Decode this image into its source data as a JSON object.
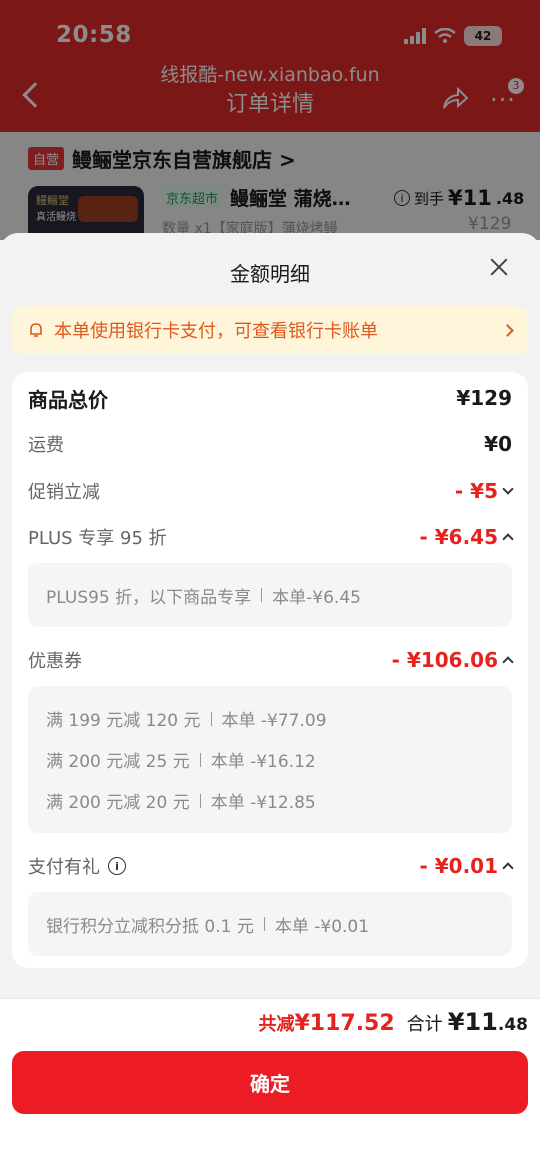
{
  "status": {
    "time": "20:58",
    "battery": "42"
  },
  "watermark": "线报酷-new.xianbao.fun",
  "nav": {
    "title": "订单详情",
    "more_badge": "3"
  },
  "store": {
    "tag": "自营",
    "name": "鳗鲡堂京东自营旗舰店 >"
  },
  "product": {
    "image_text_1": "鳗鲡堂",
    "image_text_2": "真活鳗烧",
    "channel_tag": "京东超市",
    "name": "鳗鲡堂 蒲烧…",
    "price_label": "到手",
    "price_int": "¥11",
    "price_dec": ".48",
    "subtitle": "数量 x1【家庭版】蒲烧烤鳗",
    "original_price": "¥129"
  },
  "sheet": {
    "title": "金额明细",
    "notice": "本单使用银行卡支付，可查看银行卡账单",
    "rows": {
      "total": {
        "label": "商品总价",
        "value": "¥129"
      },
      "shipping": {
        "label": "运费",
        "value": "¥0"
      },
      "promo": {
        "label": "促销立减",
        "value": "- ¥5"
      },
      "plus": {
        "label": "PLUS 专享 95 折",
        "value": "- ¥6.45",
        "details": [
          {
            "desc": "PLUS95 折，以下商品专享",
            "amount": "本单-¥6.45"
          }
        ]
      },
      "coupon": {
        "label": "优惠券",
        "value": "- ¥106.06",
        "details": [
          {
            "desc": "满 199 元减 120 元",
            "amount": "本单 -¥77.09"
          },
          {
            "desc": "满 200 元减 25 元",
            "amount": "本单 -¥16.12"
          },
          {
            "desc": "满 200 元减 20 元",
            "amount": "本单 -¥12.85"
          }
        ]
      },
      "gift": {
        "label": "支付有礼",
        "value": "- ¥0.01",
        "details": [
          {
            "desc": "银行积分立减积分抵 0.1 元",
            "amount": "本单 -¥0.01"
          }
        ]
      }
    }
  },
  "footer": {
    "save_label": "共减",
    "save_value": "¥117.52",
    "sum_label": "合计",
    "sum_int": "¥11",
    "sum_dec": ".48",
    "confirm": "确定"
  },
  "colors": {
    "accent": "#ed1c24",
    "discount": "#e4231f",
    "notice": "#e0591c"
  }
}
